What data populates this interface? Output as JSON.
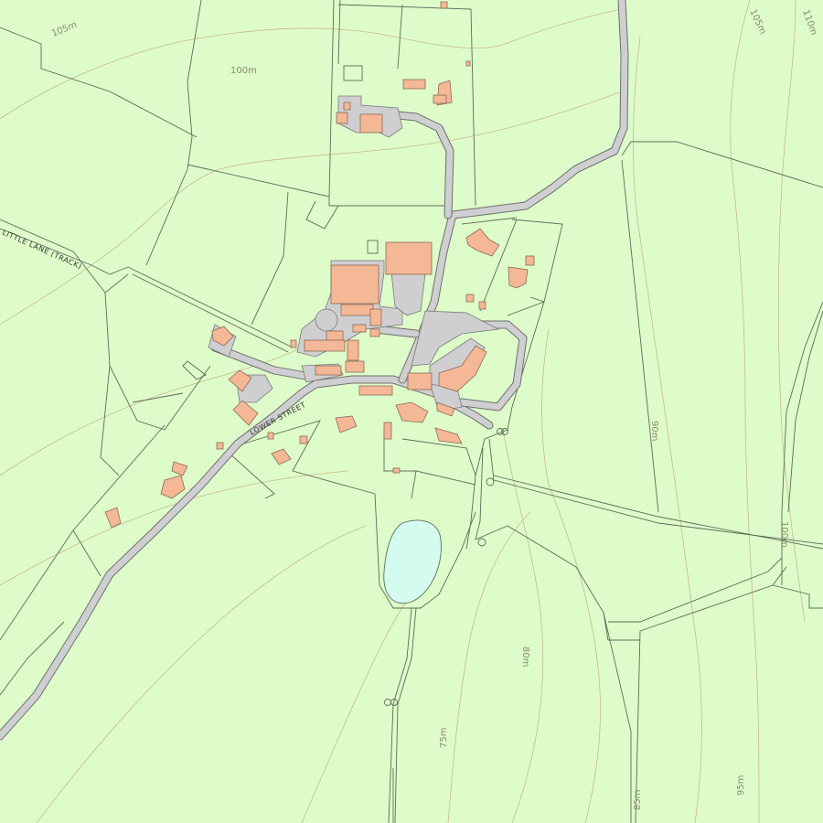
{
  "map": {
    "road_labels": {
      "lower_street": "LOWER STREET",
      "little_lane": "LITTLE LANE (TRACK)"
    },
    "contour_labels": {
      "c105_nw": "105m",
      "c100_n": "100m",
      "c105_ne": "105m",
      "c110_ne": "110m",
      "c90_e": "90m",
      "c100_e": "100m",
      "c80_s": "80m",
      "c75_s": "75m",
      "c85_s": "85m",
      "c95_se": "95m"
    },
    "colors": {
      "background": "#ddfcc9",
      "road": "#cfcfd1",
      "building": "#f5b896",
      "water": "#d4fbf0",
      "contour": "#c8b98c",
      "boundary": "#5f6b5a"
    }
  }
}
